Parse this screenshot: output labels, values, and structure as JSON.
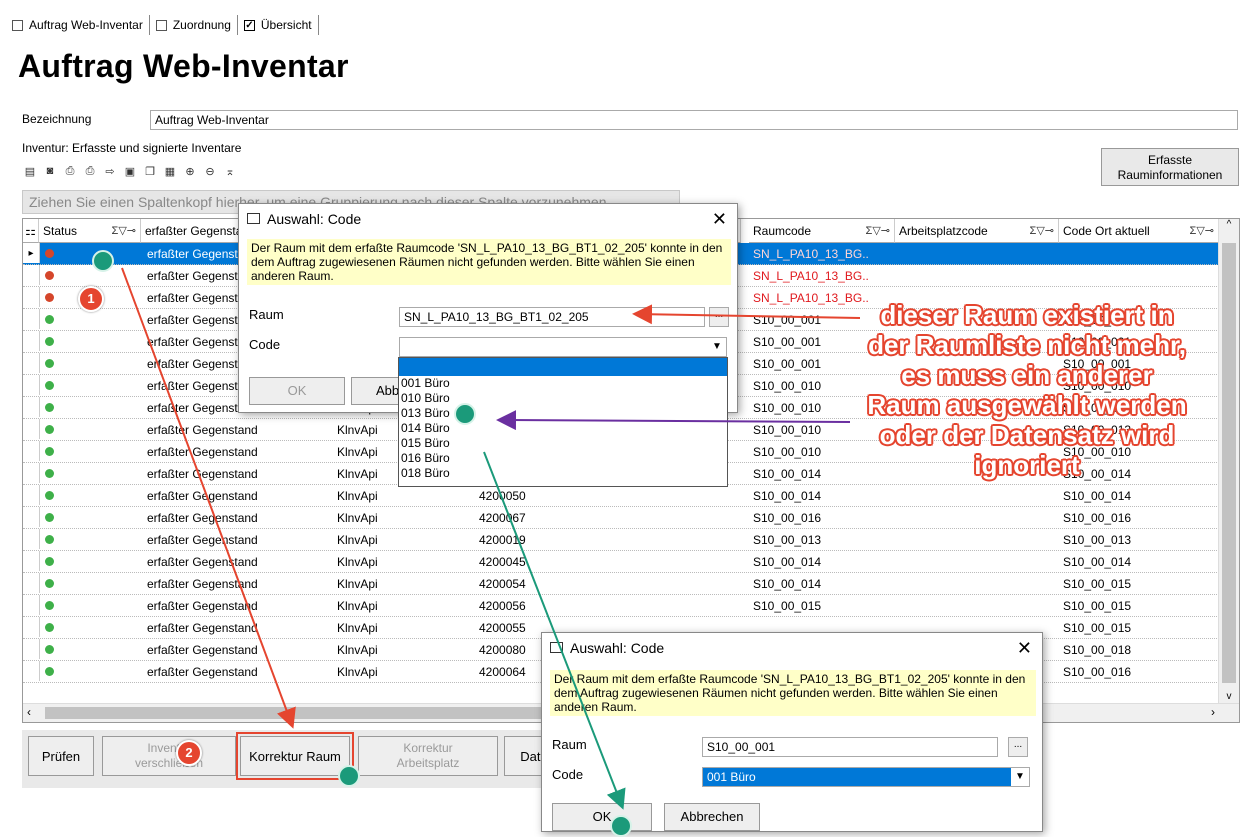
{
  "tabs": [
    {
      "label": "Auftrag Web-Inventar",
      "checked": false
    },
    {
      "label": "Zuordnung",
      "checked": false
    },
    {
      "label": "Übersicht",
      "checked": true
    }
  ],
  "page_title": "Auftrag Web-Inventar",
  "bezeichnung": {
    "label": "Bezeichnung",
    "value": "Auftrag Web-Inventar"
  },
  "section_label": "Inventur: Erfasste und signierte Inventare",
  "erfasste_button": {
    "line1": "Erfasste",
    "line2": "Rauminformationen"
  },
  "group_hint": "Ziehen Sie einen Spaltenkopf hierher, um eine Gruppierung nach dieser Spalte vorzunehmen",
  "columns": {
    "status": "Status",
    "erfasst": "erfaßter Gegenstand",
    "raumcode": "Raumcode",
    "arbeitsplatz": "Arbeitsplatzcode",
    "codeort": "Code Ort aktuell",
    "sig": "Σ▽⊸"
  },
  "rows": [
    {
      "status": "red",
      "erfasst": "erfaßter Gegenstand",
      "klnv": "",
      "nr": "",
      "raum": "SN_L_PA10_13_BG..",
      "ort": "",
      "sel": true
    },
    {
      "status": "red",
      "erfasst": "erfaßter Gegenstand",
      "klnv": "",
      "nr": "",
      "raum": "SN_L_PA10_13_BG..",
      "ort": ""
    },
    {
      "status": "red",
      "erfasst": "erfaßter Gegenstand",
      "klnv": "",
      "nr": "",
      "raum": "SN_L_PA10_13_BG..",
      "ort": ""
    },
    {
      "status": "green",
      "erfasst": "erfaßter Gegenstand",
      "klnv": "",
      "nr": "",
      "raum": "S10_00_001",
      "ort": "S10_00_001"
    },
    {
      "status": "green",
      "erfasst": "erfaßter Gegenstand",
      "klnv": "",
      "nr": "",
      "raum": "S10_00_001",
      "ort": "S10_00_001"
    },
    {
      "status": "green",
      "erfasst": "erfaßter Gegenstand",
      "klnv": "",
      "nr": "",
      "raum": "S10_00_001",
      "ort": "S10_00_001"
    },
    {
      "status": "green",
      "erfasst": "erfaßter Gegenstand",
      "klnv": "",
      "nr": "",
      "raum": "S10_00_010",
      "ort": "S10_00_010"
    },
    {
      "status": "green",
      "erfasst": "erfaßter Gegenstand",
      "klnv": "KlnvApi",
      "nr": "",
      "raum": "S10_00_010",
      "ort": "S10_00_010"
    },
    {
      "status": "green",
      "erfasst": "erfaßter Gegenstand",
      "klnv": "KlnvApi",
      "nr": "",
      "raum": "S10_00_010",
      "ort": "S10_00_013"
    },
    {
      "status": "green",
      "erfasst": "erfaßter Gegenstand",
      "klnv": "KlnvApi",
      "nr": "",
      "raum": "S10_00_010",
      "ort": "S10_00_010"
    },
    {
      "status": "green",
      "erfasst": "erfaßter Gegenstand",
      "klnv": "KlnvApi",
      "nr": "4200048",
      "raum": "S10_00_014",
      "ort": "S10_00_014"
    },
    {
      "status": "green",
      "erfasst": "erfaßter Gegenstand",
      "klnv": "KlnvApi",
      "nr": "4200050",
      "raum": "S10_00_014",
      "ort": "S10_00_014"
    },
    {
      "status": "green",
      "erfasst": "erfaßter Gegenstand",
      "klnv": "KlnvApi",
      "nr": "4200067",
      "raum": "S10_00_016",
      "ort": "S10_00_016"
    },
    {
      "status": "green",
      "erfasst": "erfaßter Gegenstand",
      "klnv": "KlnvApi",
      "nr": "4200019",
      "raum": "S10_00_013",
      "ort": "S10_00_013"
    },
    {
      "status": "green",
      "erfasst": "erfaßter Gegenstand",
      "klnv": "KlnvApi",
      "nr": "4200045",
      "raum": "S10_00_014",
      "ort": "S10_00_014"
    },
    {
      "status": "green",
      "erfasst": "erfaßter Gegenstand",
      "klnv": "KlnvApi",
      "nr": "4200054",
      "raum": "S10_00_014",
      "ort": "S10_00_015"
    },
    {
      "status": "green",
      "erfasst": "erfaßter Gegenstand",
      "klnv": "KlnvApi",
      "nr": "4200056",
      "raum": "S10_00_015",
      "ort": "S10_00_015"
    },
    {
      "status": "green",
      "erfasst": "erfaßter Gegenstand",
      "klnv": "KlnvApi",
      "nr": "4200055",
      "raum": "",
      "ort": "S10_00_015"
    },
    {
      "status": "green",
      "erfasst": "erfaßter Gegenstand",
      "klnv": "KlnvApi",
      "nr": "4200080",
      "raum": "",
      "ort": "S10_00_018"
    },
    {
      "status": "green",
      "erfasst": "erfaßter Gegenstand",
      "klnv": "KlnvApi",
      "nr": "4200064",
      "raum": "",
      "ort": "S10_00_016"
    }
  ],
  "buttons": {
    "pruefen": "Prüfen",
    "inventur_line1": "Inventur",
    "inventur_line2": "verschließen",
    "korrektur_raum": "Korrektur Raum",
    "korrektur_ap_line1": "Korrektur",
    "korrektur_ap_line2": "Arbeitsplatz",
    "date": "Date"
  },
  "dialog1": {
    "title": "Auswahl: Code",
    "message": "Der Raum mit dem erfaßte Raumcode 'SN_L_PA10_13_BG_BT1_02_205' konnte in den dem Auftrag zugewiesenen Räumen nicht gefunden werden. Bitte wählen Sie einen anderen Raum.",
    "raum_label": "Raum",
    "raum_value": "SN_L_PA10_13_BG_BT1_02_205",
    "code_label": "Code",
    "code_value": "",
    "ok": "OK",
    "abbrechen": "Abb",
    "options": [
      "001 Büro",
      "010 Büro",
      "013 Büro",
      "014 Büro",
      "015 Büro",
      "016 Büro",
      "018 Büro"
    ]
  },
  "dialog2": {
    "title": "Auswahl: Code",
    "message": "Der Raum mit dem erfaßte Raumcode 'SN_L_PA10_13_BG_BT1_02_205' konnte in den dem Auftrag zugewiesenen Räumen nicht gefunden werden. Bitte wählen Sie einen anderen Raum.",
    "raum_label": "Raum",
    "raum_value": "S10_00_001",
    "code_label": "Code",
    "code_value": "001 Büro",
    "ok": "OK",
    "abbrechen": "Abbrechen"
  },
  "annotation": {
    "line1": "dieser Raum existiert in",
    "line2": "der Raumliste nicht mehr,",
    "line3": "es muss ein anderer",
    "line4": "Raum ausgewählt werden",
    "line5": "oder der Datensatz wird",
    "line6": "ignoriert"
  },
  "badges": {
    "one": "1",
    "two": "2"
  },
  "colors": {
    "selection": "#0078d7",
    "annotation_red": "#e5452f",
    "status_red": "#d5462b",
    "status_green": "#3eb049",
    "arrow_purple": "#6a2fa0",
    "arrow_teal": "#1b9a7a"
  }
}
